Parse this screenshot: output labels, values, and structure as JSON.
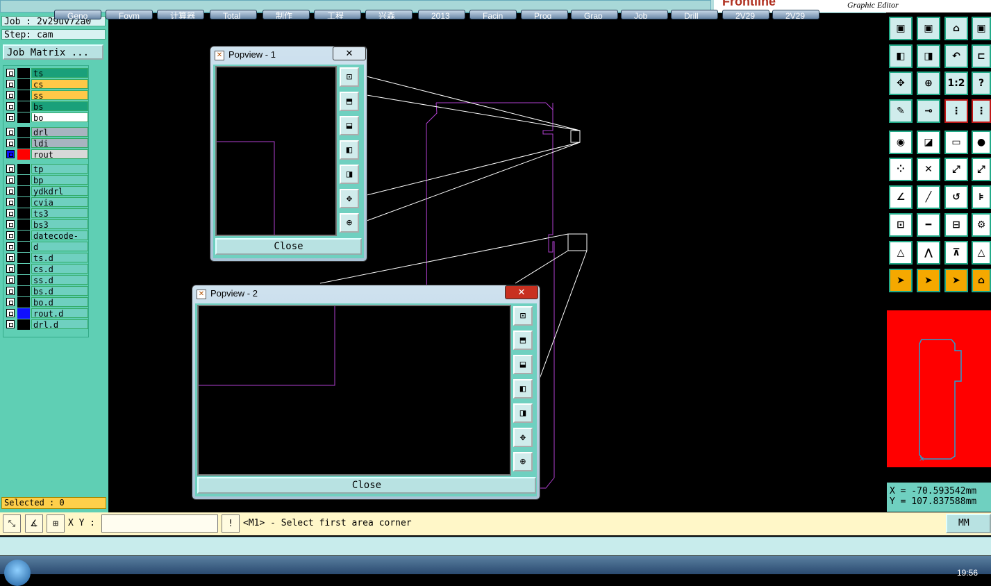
{
  "header": {
    "brand_sub": "Graphic Editor",
    "brand_logo": "Frontline"
  },
  "job": {
    "job_label": "Job : 2v29uv72a0",
    "step_label": "Step: cam",
    "matrix_button": "Job Matrix ..."
  },
  "layers": [
    {
      "name": "ts",
      "color": "#1aa07a"
    },
    {
      "name": "cs",
      "color": "#ffc848"
    },
    {
      "name": "ss",
      "color": "#ffc848"
    },
    {
      "name": "bs",
      "color": "#1aa07a"
    },
    {
      "name": "bo",
      "color": "#ffffff"
    },
    {
      "name": "drl",
      "color": "#a8b4c0"
    },
    {
      "name": "ldi",
      "color": "#a8b4c0"
    },
    {
      "name": "rout",
      "color": "#d8d8d8",
      "active": true,
      "swatch": "#ff0000"
    },
    {
      "name": "tp",
      "color": "#6fd0c0"
    },
    {
      "name": "bp",
      "color": "#6fd0c0"
    },
    {
      "name": "ydkdrl",
      "color": "#6fd0c0"
    },
    {
      "name": "cvia",
      "color": "#6fd0c0"
    },
    {
      "name": "ts3",
      "color": "#6fd0c0"
    },
    {
      "name": "bs3",
      "color": "#6fd0c0"
    },
    {
      "name": "datecode-bo",
      "color": "#6fd0c0"
    },
    {
      "name": "d",
      "color": "#6fd0c0"
    },
    {
      "name": "ts.d",
      "color": "#6fd0c0"
    },
    {
      "name": "cs.d",
      "color": "#6fd0c0"
    },
    {
      "name": "ss.d",
      "color": "#6fd0c0"
    },
    {
      "name": "bs.d",
      "color": "#6fd0c0"
    },
    {
      "name": "bo.d",
      "color": "#6fd0c0"
    },
    {
      "name": "rout.d",
      "color": "#6fd0c0",
      "swatch": "#1010ff"
    },
    {
      "name": "drl.d",
      "color": "#6fd0c0"
    }
  ],
  "selected_label": "Selected : 0",
  "coords": {
    "x": "X = -70.593542mm",
    "y": "Y = 107.837588mm"
  },
  "command": {
    "xy_label": "X Y :",
    "xy_value": "",
    "message": "<M1> - Select first area corner",
    "units": "MM"
  },
  "popup1": {
    "title": "Popview - 1",
    "close_label": "Close"
  },
  "popup2": {
    "title": "Popview - 2",
    "close_label": "Close"
  },
  "tools": {
    "rows": [
      [
        "▣",
        "▣",
        "⌂",
        "▣"
      ],
      [
        "◧",
        "◨",
        "↶",
        "⊏"
      ],
      [
        "✥",
        "⊕",
        "1:2",
        "?"
      ],
      [
        "✎",
        "⊸",
        "⋮",
        "⋮"
      ],
      [
        "◉",
        "◪",
        "▭",
        "●"
      ],
      [
        "⁘",
        "✕",
        "⤢",
        "⤢"
      ],
      [
        "∠",
        "╱",
        "↺",
        "⊧"
      ],
      [
        "⊡",
        "━",
        "⊟",
        "⚙"
      ],
      [
        "△",
        "⋀",
        "⊼",
        "△"
      ],
      [
        "➤",
        "➤",
        "➤",
        "⌂"
      ]
    ]
  },
  "taskbar": {
    "items": [
      "Geno",
      "Fovm",
      "计算器",
      "Total",
      "制作",
      "工程",
      "兴森",
      "2013",
      "Facin",
      "Prog",
      "Grap",
      "Job",
      "Drill",
      "2V29",
      "2V29"
    ],
    "clock": "19:56"
  },
  "colors": {
    "canvas": "#000000",
    "panel": "#5fcfb4",
    "rout": "#ff0000",
    "outline": "#b040d0"
  }
}
